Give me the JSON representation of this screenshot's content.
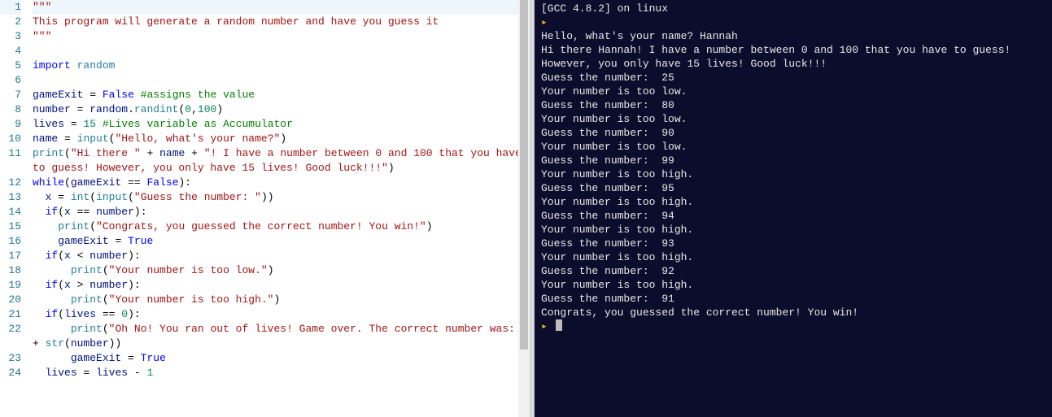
{
  "editor": {
    "line_numbers": [
      "1",
      "2",
      "3",
      "4",
      "5",
      "6",
      "7",
      "8",
      "9",
      "10",
      "11",
      "12",
      "13",
      "14",
      "15",
      "16",
      "17",
      "18",
      "19",
      "20",
      "21",
      "22",
      "23",
      "24"
    ],
    "current_line_index": 0,
    "lines": [
      {
        "indent": 0,
        "tokens": [
          {
            "cls": "str",
            "t": "\"\"\""
          }
        ]
      },
      {
        "indent": 0,
        "tokens": [
          {
            "cls": "str",
            "t": "This program will generate a random number and have you guess it"
          }
        ]
      },
      {
        "indent": 0,
        "tokens": [
          {
            "cls": "str",
            "t": "\"\"\""
          }
        ]
      },
      {
        "indent": 0,
        "tokens": []
      },
      {
        "indent": 0,
        "tokens": [
          {
            "cls": "kw",
            "t": "import"
          },
          {
            "cls": "",
            "t": " "
          },
          {
            "cls": "mod",
            "t": "random"
          }
        ]
      },
      {
        "indent": 0,
        "tokens": []
      },
      {
        "indent": 0,
        "tokens": [
          {
            "cls": "id",
            "t": "gameExit"
          },
          {
            "cls": "",
            "t": " "
          },
          {
            "cls": "op",
            "t": "="
          },
          {
            "cls": "",
            "t": " "
          },
          {
            "cls": "bool",
            "t": "False"
          },
          {
            "cls": "",
            "t": " "
          },
          {
            "cls": "cmt",
            "t": "#assigns the value"
          }
        ]
      },
      {
        "indent": 0,
        "tokens": [
          {
            "cls": "id",
            "t": "number"
          },
          {
            "cls": "",
            "t": " "
          },
          {
            "cls": "op",
            "t": "="
          },
          {
            "cls": "",
            "t": " "
          },
          {
            "cls": "id",
            "t": "random"
          },
          {
            "cls": "op",
            "t": "."
          },
          {
            "cls": "fn",
            "t": "randint"
          },
          {
            "cls": "op",
            "t": "("
          },
          {
            "cls": "num",
            "t": "0"
          },
          {
            "cls": "op",
            "t": ","
          },
          {
            "cls": "num",
            "t": "100"
          },
          {
            "cls": "op",
            "t": ")"
          }
        ]
      },
      {
        "indent": 0,
        "tokens": [
          {
            "cls": "id",
            "t": "lives"
          },
          {
            "cls": "",
            "t": " "
          },
          {
            "cls": "op",
            "t": "="
          },
          {
            "cls": "",
            "t": " "
          },
          {
            "cls": "num",
            "t": "15"
          },
          {
            "cls": "",
            "t": " "
          },
          {
            "cls": "cmt",
            "t": "#Lives variable as Accumulator"
          }
        ]
      },
      {
        "indent": 0,
        "tokens": [
          {
            "cls": "id",
            "t": "name"
          },
          {
            "cls": "",
            "t": " "
          },
          {
            "cls": "op",
            "t": "="
          },
          {
            "cls": "",
            "t": " "
          },
          {
            "cls": "bi",
            "t": "input"
          },
          {
            "cls": "op",
            "t": "("
          },
          {
            "cls": "str",
            "t": "\"Hello, what's your name?\""
          },
          {
            "cls": "op",
            "t": ")"
          }
        ]
      },
      {
        "indent": 0,
        "wrap": true,
        "tokens": [
          {
            "cls": "bi",
            "t": "print"
          },
          {
            "cls": "op",
            "t": "("
          },
          {
            "cls": "str",
            "t": "\"Hi there \""
          },
          {
            "cls": "",
            "t": " "
          },
          {
            "cls": "op",
            "t": "+"
          },
          {
            "cls": "",
            "t": " "
          },
          {
            "cls": "id",
            "t": "name"
          },
          {
            "cls": "",
            "t": " "
          },
          {
            "cls": "op",
            "t": "+"
          },
          {
            "cls": "",
            "t": " "
          },
          {
            "cls": "str",
            "t": "\"! I have a number between 0 and 100 that you have to guess! However, you only have 15 lives! Good luck!!!\""
          },
          {
            "cls": "op",
            "t": ")"
          }
        ]
      },
      {
        "indent": 0,
        "tokens": [
          {
            "cls": "kw",
            "t": "while"
          },
          {
            "cls": "op",
            "t": "("
          },
          {
            "cls": "id",
            "t": "gameExit"
          },
          {
            "cls": "",
            "t": " "
          },
          {
            "cls": "op",
            "t": "=="
          },
          {
            "cls": "",
            "t": " "
          },
          {
            "cls": "bool",
            "t": "False"
          },
          {
            "cls": "op",
            "t": "):"
          }
        ]
      },
      {
        "indent": 1,
        "tokens": [
          {
            "cls": "id",
            "t": "x"
          },
          {
            "cls": "",
            "t": " "
          },
          {
            "cls": "op",
            "t": "="
          },
          {
            "cls": "",
            "t": " "
          },
          {
            "cls": "bi",
            "t": "int"
          },
          {
            "cls": "op",
            "t": "("
          },
          {
            "cls": "bi",
            "t": "input"
          },
          {
            "cls": "op",
            "t": "("
          },
          {
            "cls": "str",
            "t": "\"Guess the number: \""
          },
          {
            "cls": "op",
            "t": "))"
          }
        ]
      },
      {
        "indent": 1,
        "tokens": [
          {
            "cls": "kw",
            "t": "if"
          },
          {
            "cls": "op",
            "t": "("
          },
          {
            "cls": "id",
            "t": "x"
          },
          {
            "cls": "",
            "t": " "
          },
          {
            "cls": "op",
            "t": "=="
          },
          {
            "cls": "",
            "t": " "
          },
          {
            "cls": "id",
            "t": "number"
          },
          {
            "cls": "op",
            "t": "):"
          }
        ]
      },
      {
        "indent": 2,
        "tokens": [
          {
            "cls": "bi",
            "t": "print"
          },
          {
            "cls": "op",
            "t": "("
          },
          {
            "cls": "str",
            "t": "\"Congrats, you guessed the correct number! You win!\""
          },
          {
            "cls": "op",
            "t": ")"
          }
        ]
      },
      {
        "indent": 2,
        "tokens": [
          {
            "cls": "id",
            "t": "gameExit"
          },
          {
            "cls": "",
            "t": " "
          },
          {
            "cls": "op",
            "t": "="
          },
          {
            "cls": "",
            "t": " "
          },
          {
            "cls": "bool",
            "t": "True"
          }
        ]
      },
      {
        "indent": 1,
        "tokens": [
          {
            "cls": "kw",
            "t": "if"
          },
          {
            "cls": "op",
            "t": "("
          },
          {
            "cls": "id",
            "t": "x"
          },
          {
            "cls": "",
            "t": " "
          },
          {
            "cls": "op",
            "t": "<"
          },
          {
            "cls": "",
            "t": " "
          },
          {
            "cls": "id",
            "t": "number"
          },
          {
            "cls": "op",
            "t": "):"
          }
        ]
      },
      {
        "indent": 3,
        "tokens": [
          {
            "cls": "bi",
            "t": "print"
          },
          {
            "cls": "op",
            "t": "("
          },
          {
            "cls": "str",
            "t": "\"Your number is too low.\""
          },
          {
            "cls": "op",
            "t": ")"
          }
        ]
      },
      {
        "indent": 1,
        "tokens": [
          {
            "cls": "kw",
            "t": "if"
          },
          {
            "cls": "op",
            "t": "("
          },
          {
            "cls": "id",
            "t": "x"
          },
          {
            "cls": "",
            "t": " "
          },
          {
            "cls": "op",
            "t": ">"
          },
          {
            "cls": "",
            "t": " "
          },
          {
            "cls": "id",
            "t": "number"
          },
          {
            "cls": "op",
            "t": "):"
          }
        ]
      },
      {
        "indent": 3,
        "tokens": [
          {
            "cls": "bi",
            "t": "print"
          },
          {
            "cls": "op",
            "t": "("
          },
          {
            "cls": "str",
            "t": "\"Your number is too high.\""
          },
          {
            "cls": "op",
            "t": ")"
          }
        ]
      },
      {
        "indent": 1,
        "tokens": [
          {
            "cls": "kw",
            "t": "if"
          },
          {
            "cls": "op",
            "t": "("
          },
          {
            "cls": "id",
            "t": "lives"
          },
          {
            "cls": "",
            "t": " "
          },
          {
            "cls": "op",
            "t": "=="
          },
          {
            "cls": "",
            "t": " "
          },
          {
            "cls": "num",
            "t": "0"
          },
          {
            "cls": "op",
            "t": "):"
          }
        ]
      },
      {
        "indent": 3,
        "wrap": true,
        "tokens": [
          {
            "cls": "bi",
            "t": "print"
          },
          {
            "cls": "op",
            "t": "("
          },
          {
            "cls": "str",
            "t": "\"Oh No! You ran out of lives! Game over. The correct number was: \""
          },
          {
            "cls": "",
            "t": " "
          },
          {
            "cls": "op",
            "t": "+"
          },
          {
            "cls": "",
            "t": " "
          },
          {
            "cls": "bi",
            "t": "str"
          },
          {
            "cls": "op",
            "t": "("
          },
          {
            "cls": "id",
            "t": "number"
          },
          {
            "cls": "op",
            "t": "))"
          }
        ]
      },
      {
        "indent": 3,
        "tokens": [
          {
            "cls": "id",
            "t": "gameExit"
          },
          {
            "cls": "",
            "t": " "
          },
          {
            "cls": "op",
            "t": "="
          },
          {
            "cls": "",
            "t": " "
          },
          {
            "cls": "bool",
            "t": "True"
          }
        ]
      },
      {
        "indent": 1,
        "tokens": [
          {
            "cls": "id",
            "t": "lives"
          },
          {
            "cls": "",
            "t": " "
          },
          {
            "cls": "op",
            "t": "="
          },
          {
            "cls": "",
            "t": " "
          },
          {
            "cls": "id",
            "t": "lives"
          },
          {
            "cls": "",
            "t": " "
          },
          {
            "cls": "op",
            "t": "-"
          },
          {
            "cls": "",
            "t": " "
          },
          {
            "cls": "num",
            "t": "1"
          }
        ]
      }
    ]
  },
  "terminal": {
    "prompt_symbol": "▸",
    "lines": [
      {
        "type": "out",
        "text": "[GCC 4.8.2] on linux"
      },
      {
        "type": "prompt",
        "text": ""
      },
      {
        "type": "out",
        "text": "Hello, what's your name? Hannah"
      },
      {
        "type": "out",
        "text": "Hi there Hannah! I have a number between 0 and 100 that you have to guess! However, you only have 15 lives! Good luck!!!"
      },
      {
        "type": "out",
        "text": "Guess the number:  25"
      },
      {
        "type": "out",
        "text": "Your number is too low."
      },
      {
        "type": "out",
        "text": "Guess the number:  80"
      },
      {
        "type": "out",
        "text": "Your number is too low."
      },
      {
        "type": "out",
        "text": "Guess the number:  90"
      },
      {
        "type": "out",
        "text": "Your number is too low."
      },
      {
        "type": "out",
        "text": "Guess the number:  99"
      },
      {
        "type": "out",
        "text": "Your number is too high."
      },
      {
        "type": "out",
        "text": "Guess the number:  95"
      },
      {
        "type": "out",
        "text": "Your number is too high."
      },
      {
        "type": "out",
        "text": "Guess the number:  94"
      },
      {
        "type": "out",
        "text": "Your number is too high."
      },
      {
        "type": "out",
        "text": "Guess the number:  93"
      },
      {
        "type": "out",
        "text": "Your number is too high."
      },
      {
        "type": "out",
        "text": "Guess the number:  92"
      },
      {
        "type": "out",
        "text": "Your number is too high."
      },
      {
        "type": "out",
        "text": "Guess the number:  91"
      },
      {
        "type": "out",
        "text": "Congrats, you guessed the correct number! You win!"
      },
      {
        "type": "prompt-cursor",
        "text": ""
      }
    ]
  }
}
